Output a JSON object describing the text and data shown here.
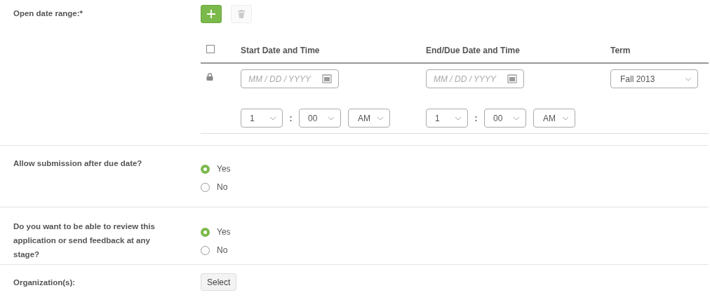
{
  "open_date_range": {
    "label": "Open date range:*",
    "actions": [
      {
        "kind": "add",
        "disabled": false
      },
      {
        "kind": "delete",
        "disabled": true
      }
    ],
    "table": {
      "header_checked": false,
      "columns": [
        "Start Date and Time",
        "End/Due Date and Time",
        "Term"
      ],
      "rows": [
        {
          "locked": true,
          "start": {
            "date_placeholder": "MM / DD / YYYY",
            "hour": "1",
            "separator": ":",
            "minute": "00",
            "ampm": "AM"
          },
          "end": {
            "date_placeholder": "MM / DD / YYYY",
            "hour": "1",
            "separator": ":",
            "minute": "00",
            "ampm": "AM"
          },
          "term": "Fall 2013"
        }
      ]
    }
  },
  "questions": [
    {
      "label": "Allow submission after due date?",
      "options": [
        {
          "label": "Yes",
          "selected": true
        },
        {
          "label": "No",
          "selected": false
        }
      ]
    },
    {
      "label": "Do you want to be able to review this application or send feedback at any stage?",
      "options": [
        {
          "label": "Yes",
          "selected": true
        },
        {
          "label": "No",
          "selected": false
        }
      ]
    }
  ],
  "organizations": {
    "label": "Organization(s):",
    "button": "Select"
  }
}
